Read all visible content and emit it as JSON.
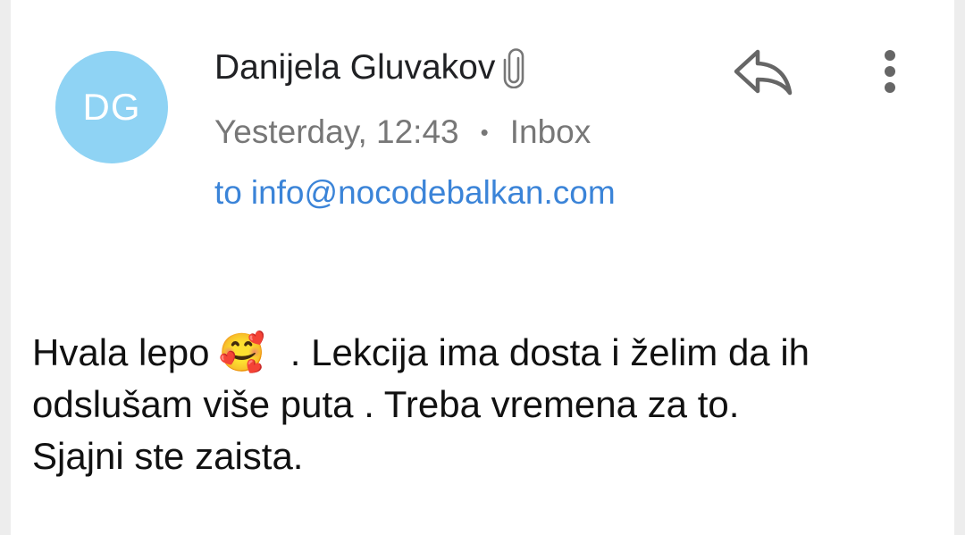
{
  "email": {
    "avatar_initials": "DG",
    "avatar_color": "#8fd3f4",
    "sender_name": "Danijela Gluvakov",
    "has_attachment_icon": "paperclip-icon",
    "timestamp": "Yesterday, 12:43",
    "separator": "•",
    "folder": "Inbox",
    "to_prefix": "to",
    "to_address": "info@nocodebalkan.com",
    "link_color": "#3b84d8"
  },
  "actions": {
    "reply_icon": "reply-icon",
    "more_icon": "more-vert-icon"
  },
  "message": {
    "line1_start": "Hvala lepo",
    "emoji": "🥰",
    "line1_end": ". Lekcija ima dosta i želim da ih",
    "line2": "odslušam više puta . Treba vremena za to.",
    "line3": "Sjajni ste zaista."
  }
}
